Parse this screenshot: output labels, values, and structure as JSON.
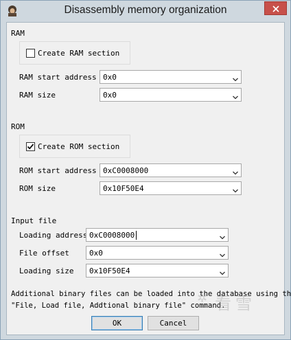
{
  "window": {
    "title": "Disassembly memory organization"
  },
  "ram": {
    "section_label": "RAM",
    "create_label": "Create RAM section",
    "create_checked": false,
    "start_label": "RAM start address",
    "start_value": "0x0",
    "size_label": "RAM size",
    "size_value": "0x0"
  },
  "rom": {
    "section_label": "ROM",
    "create_label": "Create ROM section",
    "create_checked": true,
    "start_label": "ROM start address",
    "start_value": "0xC0008000",
    "size_label": "ROM size",
    "size_value": "0x10F50E4"
  },
  "input_file": {
    "section_label": "Input file",
    "loading_address_label": "Loading address",
    "loading_address_value": "0xC0008000",
    "file_offset_label": "File offset",
    "file_offset_value": "0x0",
    "loading_size_label": "Loading size",
    "loading_size_value": "0x10F50E4"
  },
  "info": {
    "line1": "Additional binary files can be loaded into the database using the",
    "line2": "\"File, Load file, Addtional binary file\" command."
  },
  "buttons": {
    "ok": "OK",
    "cancel": "Cancel"
  },
  "watermark": "看雪",
  "icons": {
    "app": "ida-app-icon",
    "close": "close-icon",
    "dropdown": "chevron-down-icon",
    "check": "check-icon"
  }
}
